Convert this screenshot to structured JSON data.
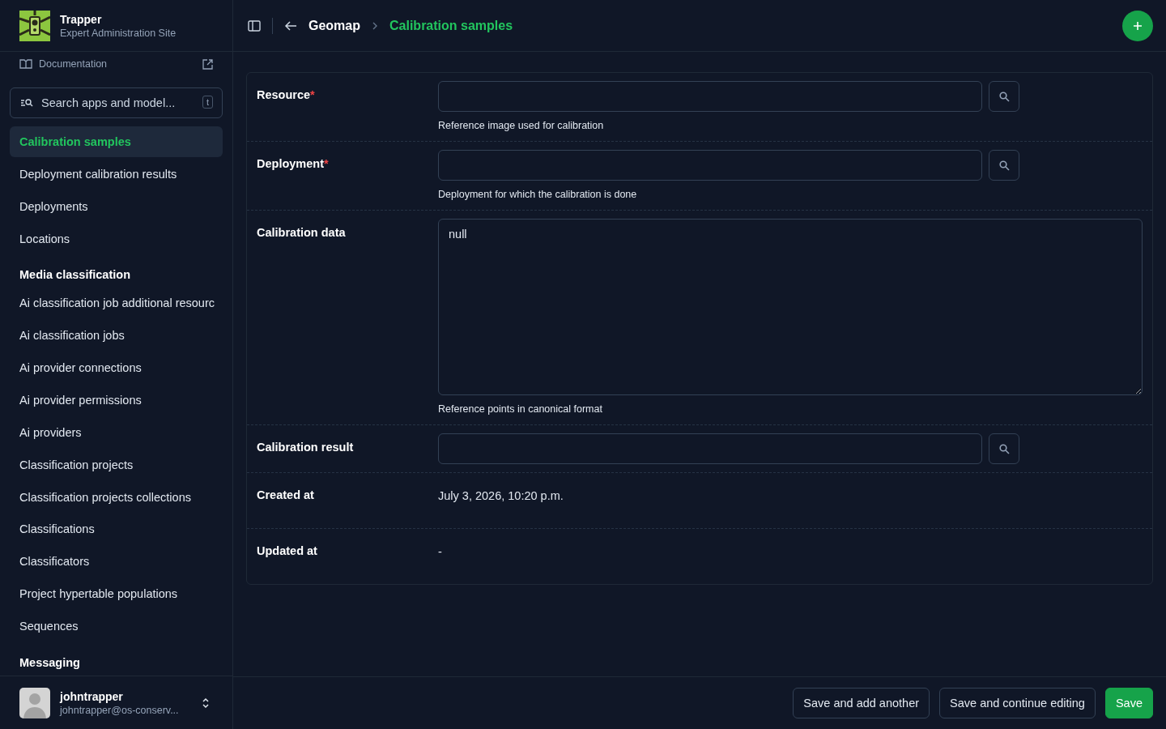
{
  "brand": {
    "title": "Trapper",
    "subtitle": "Expert Administration Site"
  },
  "documentation": {
    "label": "Documentation"
  },
  "search": {
    "placeholder": "Search apps and model...",
    "shortcut": "t"
  },
  "sidebar": {
    "groups": [
      {
        "items": [
          {
            "label": "Calibration samples",
            "selected": true
          },
          {
            "label": "Deployment calibration results",
            "selected": false
          },
          {
            "label": "Deployments",
            "selected": false
          },
          {
            "label": "Locations",
            "selected": false
          }
        ]
      },
      {
        "heading": "Media classification",
        "items": [
          {
            "label": "Ai classification job additional resourc",
            "selected": false
          },
          {
            "label": "Ai classification jobs",
            "selected": false
          },
          {
            "label": "Ai provider connections",
            "selected": false
          },
          {
            "label": "Ai provider permissions",
            "selected": false
          },
          {
            "label": "Ai providers",
            "selected": false
          },
          {
            "label": "Classification projects",
            "selected": false
          },
          {
            "label": "Classification projects collections",
            "selected": false
          },
          {
            "label": "Classifications",
            "selected": false
          },
          {
            "label": "Classificators",
            "selected": false
          },
          {
            "label": "Project hypertable populations",
            "selected": false
          },
          {
            "label": "Sequences",
            "selected": false
          }
        ]
      },
      {
        "heading": "Messaging"
      }
    ]
  },
  "user": {
    "name": "johntrapper",
    "email": "johntrapper@os-conserv..."
  },
  "breadcrumb": {
    "parent": "Geomap",
    "current": "Calibration samples"
  },
  "form": {
    "fields": [
      {
        "kind": "lookup",
        "label": "Resource",
        "required_mark": "*",
        "help": "Reference image used for calibration"
      },
      {
        "kind": "lookup",
        "label": "Deployment",
        "required_mark": "*",
        "help": "Deployment for which the calibration is done"
      },
      {
        "kind": "textarea",
        "label": "Calibration data",
        "value": "null",
        "help": "Reference points in canonical format"
      },
      {
        "kind": "lookup",
        "label": "Calibration result"
      },
      {
        "kind": "readonly",
        "label": "Created at",
        "value": "July 3, 2026, 10:20 p.m."
      },
      {
        "kind": "readonly",
        "label": "Updated at",
        "value": "-"
      }
    ]
  },
  "actions": [
    {
      "label": "Save and add another",
      "primary": false
    },
    {
      "label": "Save and continue editing",
      "primary": false
    },
    {
      "label": "Save",
      "primary": true
    }
  ]
}
